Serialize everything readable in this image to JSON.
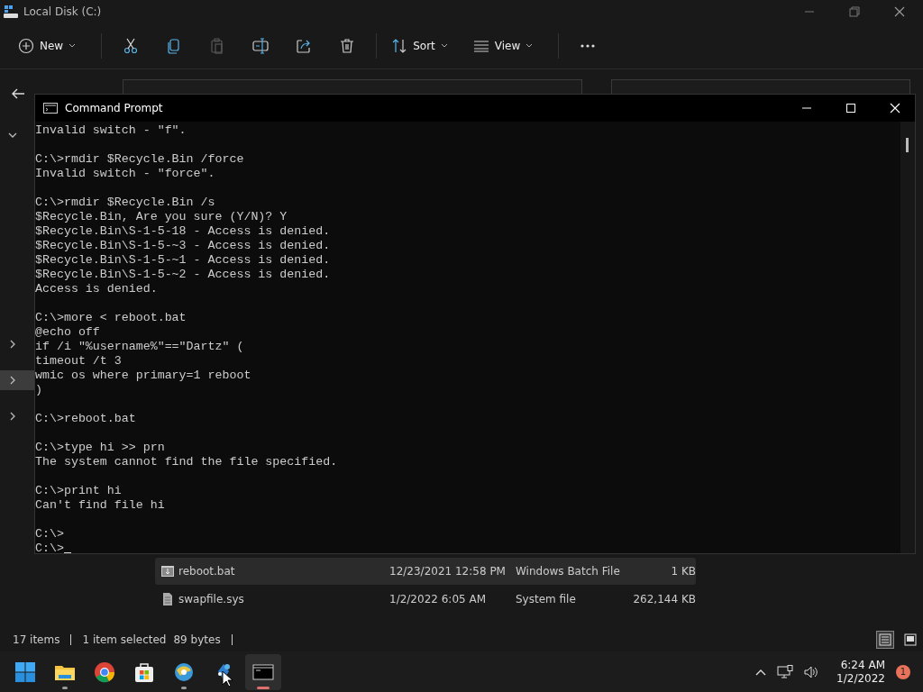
{
  "explorer": {
    "title": "Local Disk (C:)",
    "toolbar": [
      {
        "kind": "new",
        "label": "New",
        "disabled": false
      },
      {
        "kind": "cut",
        "disabled": false
      },
      {
        "kind": "copy",
        "disabled": false
      },
      {
        "kind": "paste",
        "disabled": true
      },
      {
        "kind": "rename",
        "disabled": false
      },
      {
        "kind": "share",
        "disabled": false
      },
      {
        "kind": "delete",
        "disabled": false
      },
      {
        "kind": "sort",
        "label": "Sort",
        "disabled": false
      },
      {
        "kind": "view",
        "label": "View",
        "disabled": false
      },
      {
        "kind": "more",
        "disabled": false
      }
    ],
    "nav_tree": [
      {
        "expanded": true,
        "selected": false
      },
      {
        "expanded": false,
        "selected": false
      },
      {
        "expanded": false,
        "selected": true
      },
      {
        "expanded": false,
        "selected": false
      }
    ],
    "files": [
      {
        "name": "reboot.bat",
        "date": "12/23/2021 12:58 PM",
        "type": "Windows Batch File",
        "size": "1 KB",
        "selected": true,
        "kind": "batch"
      },
      {
        "name": "swapfile.sys",
        "date": "1/2/2022 6:05 AM",
        "type": "System file",
        "size": "262,144 KB",
        "selected": false,
        "kind": "system"
      }
    ],
    "status_bar": {
      "items": "17 items",
      "selection": "1 item selected",
      "size": "89 bytes"
    },
    "view_modes": [
      {
        "kind": "details",
        "selected": true
      },
      {
        "kind": "tiles",
        "selected": false
      }
    ]
  },
  "console": {
    "title": "Command Prompt",
    "blocks": [
      [
        "Invalid switch - \"f\"."
      ],
      [
        "C:\\>rmdir $Recycle.Bin /force",
        "Invalid switch - \"force\"."
      ],
      [
        "C:\\>rmdir $Recycle.Bin /s",
        "$Recycle.Bin, Are you sure (Y/N)? Y",
        "$Recycle.Bin\\S-1-5-18 - Access is denied.",
        "$Recycle.Bin\\S-1-5-~3 - Access is denied.",
        "$Recycle.Bin\\S-1-5-~1 - Access is denied.",
        "$Recycle.Bin\\S-1-5-~2 - Access is denied.",
        "Access is denied."
      ],
      [
        "C:\\>more < reboot.bat",
        "@echo off",
        "if /i \"%username%\"==\"Dartz\" (",
        "timeout /t 3",
        "wmic os where primary=1 reboot",
        ")"
      ],
      [
        "C:\\>reboot.bat"
      ],
      [
        "C:\\>type hi >> prn",
        "The system cannot find the file specified."
      ],
      [
        "C:\\>print hi",
        "Can't find file hi"
      ],
      [
        "C:\\>",
        "C:\\>"
      ]
    ]
  },
  "taskbar": {
    "apps": [
      {
        "kind": "start",
        "running": false,
        "active": false
      },
      {
        "kind": "explorer",
        "running": true,
        "active": false
      },
      {
        "kind": "chrome",
        "running": false,
        "active": false
      },
      {
        "kind": "store",
        "running": false,
        "active": false
      },
      {
        "kind": "globe",
        "running": true,
        "active": false
      },
      {
        "kind": "paint",
        "running": false,
        "active": false
      },
      {
        "kind": "terminal",
        "running": true,
        "active": true
      }
    ],
    "time": "6:24 AM",
    "date": "1/2/2022",
    "notifications": "1"
  }
}
